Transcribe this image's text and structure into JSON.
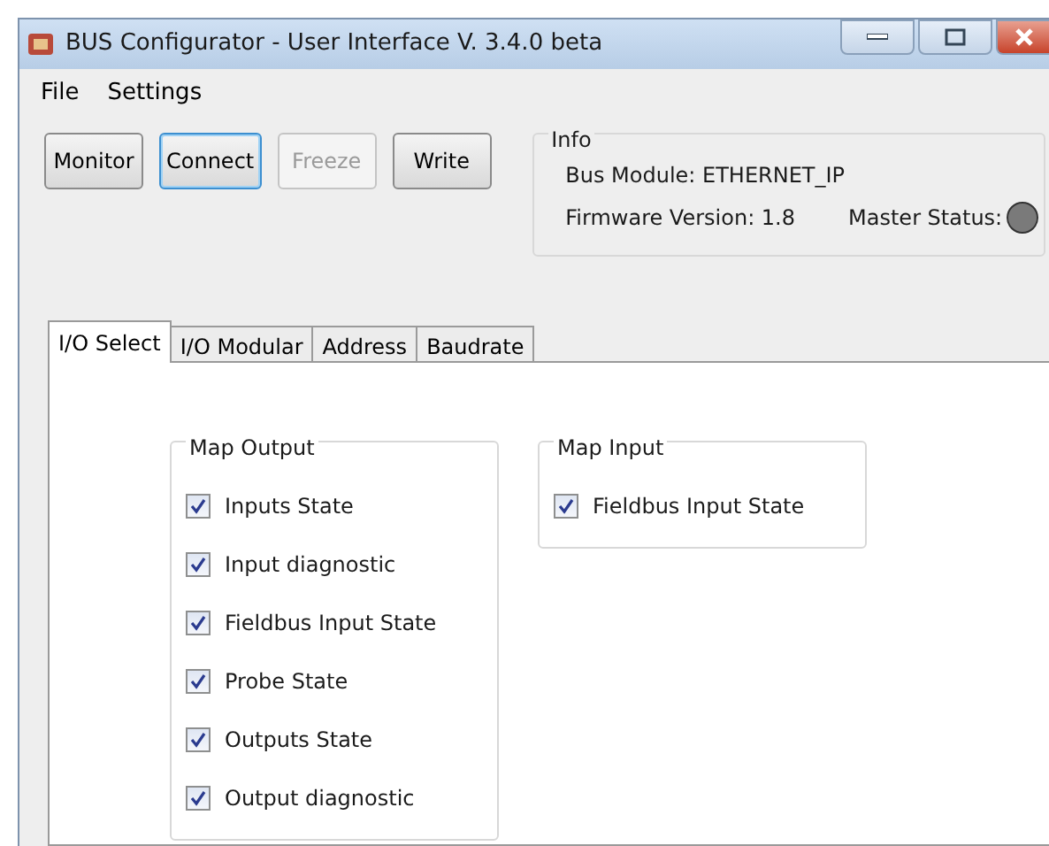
{
  "window": {
    "title": "BUS Configurator - User Interface  V. 3.4.0 beta"
  },
  "menu": [
    "File",
    "Settings"
  ],
  "buttons": [
    {
      "label": "Monitor",
      "disabled": false,
      "focused": false
    },
    {
      "label": "Connect",
      "disabled": false,
      "focused": true
    },
    {
      "label": "Freeze",
      "disabled": true,
      "focused": false
    },
    {
      "label": "Write",
      "disabled": false,
      "focused": false
    }
  ],
  "info": {
    "title": "Info",
    "bus_module": "Bus Module: ETHERNET_IP",
    "firmware_version": "Firmware Version: 1.8",
    "master_status": {
      "label": "Master Status:",
      "color": "#7a7a7a"
    }
  },
  "tabs": [
    {
      "label": "I/O Select",
      "selected": true
    },
    {
      "label": "I/O Modular",
      "selected": false
    },
    {
      "label": "Address",
      "selected": false
    },
    {
      "label": "Baudrate",
      "selected": false
    }
  ],
  "groups": [
    {
      "title": "Map Output",
      "items": [
        {
          "label": "Inputs State",
          "checked": true
        },
        {
          "label": "Input diagnostic",
          "checked": true
        },
        {
          "label": "Fieldbus Input State",
          "checked": true
        },
        {
          "label": "Probe State",
          "checked": true
        },
        {
          "label": "Outputs State",
          "checked": true
        },
        {
          "label": "Output diagnostic",
          "checked": true
        }
      ]
    },
    {
      "title": "Map Input",
      "items": [
        {
          "label": "Fieldbus Input State",
          "checked": true
        }
      ]
    }
  ]
}
